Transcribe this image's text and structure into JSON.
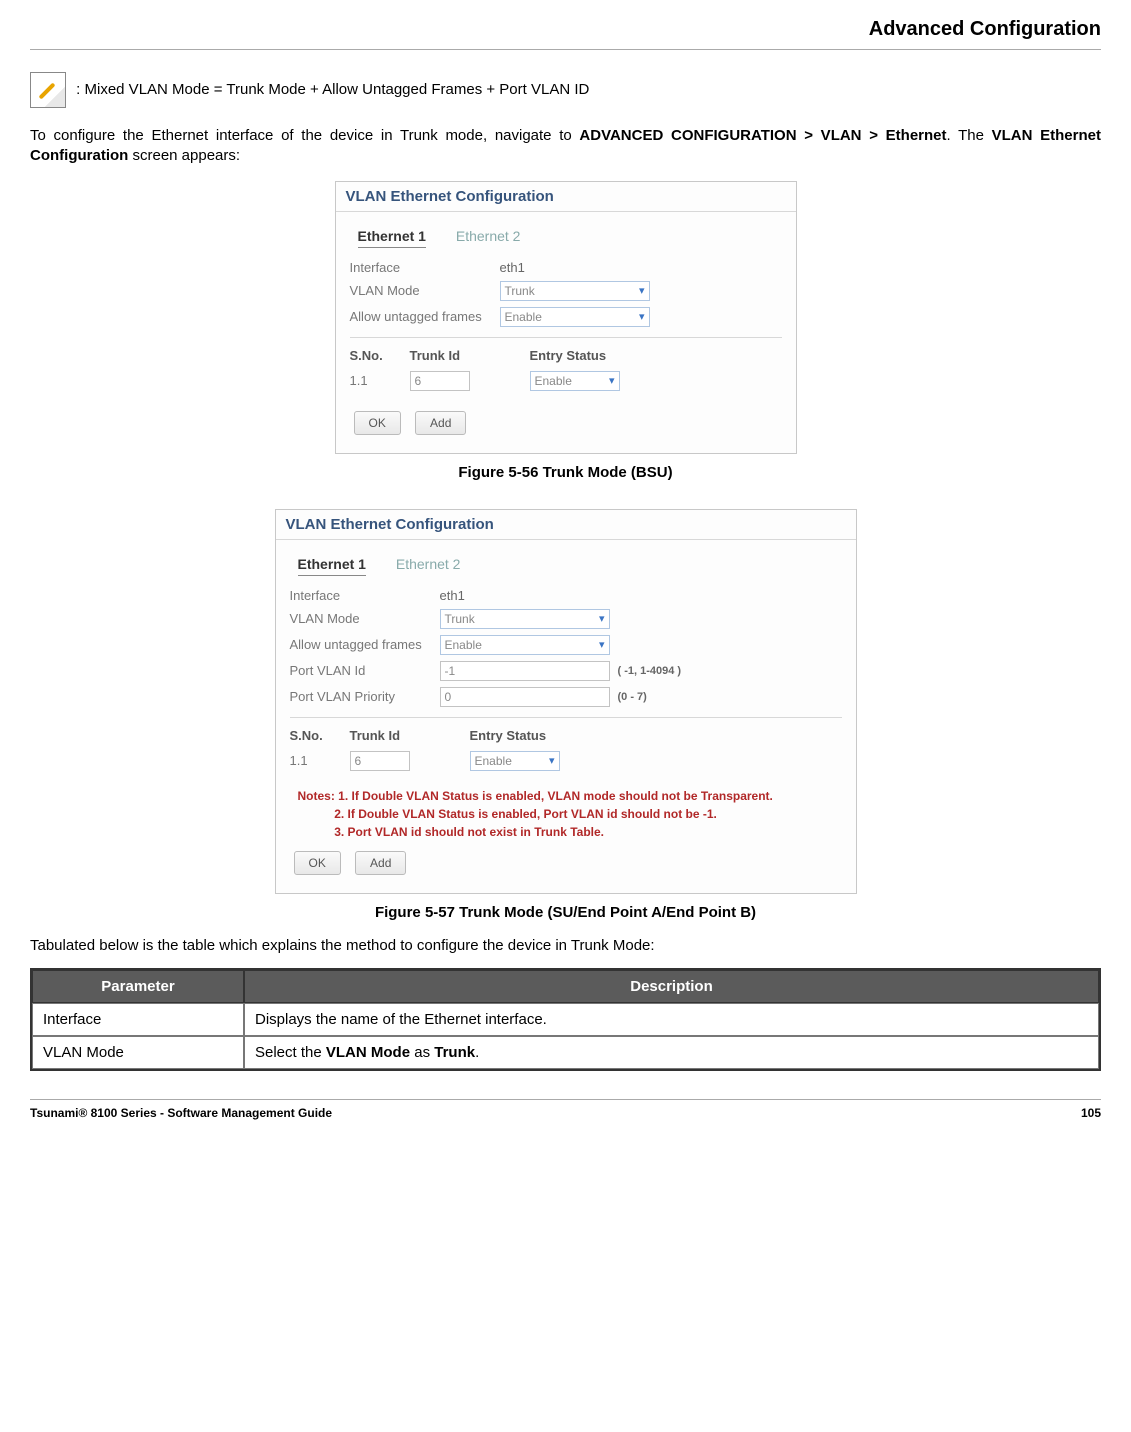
{
  "header": {
    "title": "Advanced Configuration"
  },
  "note_line": ": Mixed VLAN Mode = Trunk Mode + Allow Untagged Frames + Port VLAN ID",
  "intro": {
    "pre": "To configure the Ethernet interface of the device in Trunk mode, navigate to ",
    "path": "ADVANCED CONFIGURATION > VLAN > Ethernet",
    "post1": ". The ",
    "screen": "VLAN Ethernet Configuration",
    "post2": " screen appears:"
  },
  "panel1": {
    "title": "VLAN Ethernet Configuration",
    "tab1": "Ethernet 1",
    "tab2": "Ethernet 2",
    "rows": {
      "interface_lbl": "Interface",
      "interface_val": "eth1",
      "vlan_lbl": "VLAN Mode",
      "vlan_val": "Trunk",
      "allow_lbl": "Allow untagged frames",
      "allow_val": "Enable"
    },
    "table": {
      "h_sno": "S.No.",
      "h_trunk": "Trunk Id",
      "h_entry": "Entry Status",
      "r_sno": "1.1",
      "r_trunk": "6",
      "r_entry": "Enable"
    },
    "buttons": {
      "ok": "OK",
      "add": "Add"
    }
  },
  "caption1": "Figure 5-56 Trunk Mode (BSU)",
  "panel2": {
    "title": "VLAN Ethernet Configuration",
    "tab1": "Ethernet 1",
    "tab2": "Ethernet 2",
    "rows": {
      "interface_lbl": "Interface",
      "interface_val": "eth1",
      "vlan_lbl": "VLAN Mode",
      "vlan_val": "Trunk",
      "allow_lbl": "Allow untagged frames",
      "allow_val": "Enable",
      "portid_lbl": "Port VLAN Id",
      "portid_val": "-1",
      "portid_range": "( -1, 1-4094 )",
      "portpri_lbl": "Port VLAN Priority",
      "portpri_val": "0",
      "portpri_range": "(0 - 7)"
    },
    "table": {
      "h_sno": "S.No.",
      "h_trunk": "Trunk Id",
      "h_entry": "Entry Status",
      "r_sno": "1.1",
      "r_trunk": "6",
      "r_entry": "Enable"
    },
    "notes": {
      "head": "Notes: ",
      "n1": "1. If Double VLAN Status is enabled, VLAN mode should not be Transparent.",
      "n2": "2. If Double VLAN Status is enabled, Port VLAN id should not be -1.",
      "n3": "3. Port VLAN id should not exist in Trunk Table."
    },
    "buttons": {
      "ok": "OK",
      "add": "Add"
    }
  },
  "caption2": "Figure 5-57 Trunk Mode (SU/End Point A/End Point B)",
  "table_intro": "Tabulated below is the table which explains the method to configure the device in Trunk Mode:",
  "params": {
    "h_param": "Parameter",
    "h_desc": "Description",
    "r1_p": "Interface",
    "r1_d": "Displays the name of the Ethernet interface.",
    "r2_p": "VLAN Mode",
    "r2_d_pre": "Select the ",
    "r2_d_b1": "VLAN Mode",
    "r2_d_mid": " as ",
    "r2_d_b2": "Trunk",
    "r2_d_post": "."
  },
  "footer": {
    "left": "Tsunami® 8100 Series - Software Management Guide",
    "right": "105"
  }
}
